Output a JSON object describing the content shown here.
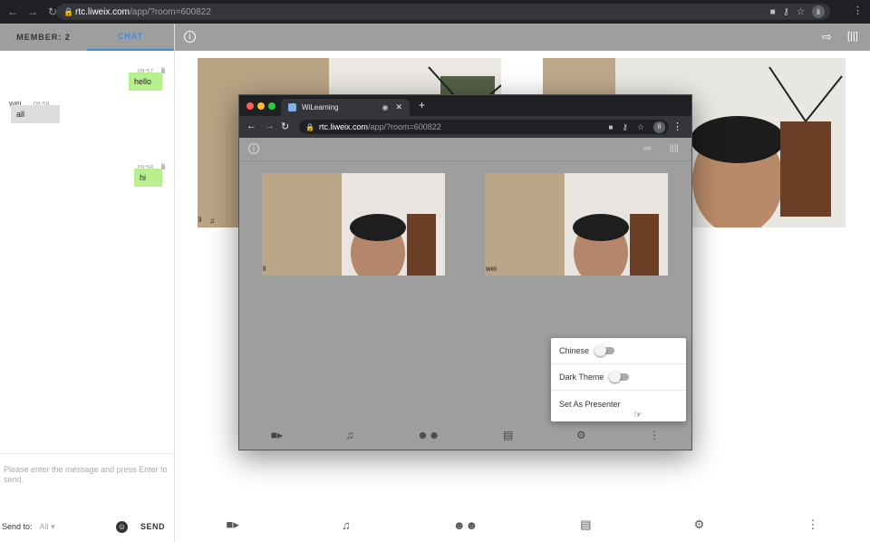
{
  "browser": {
    "url_host": "rtc.liweix.com",
    "url_path": "/app/?room=600822",
    "profile_initial": "li"
  },
  "left_panel": {
    "tabs": [
      {
        "label": "MEMBER: 2"
      },
      {
        "label": "CHAT"
      }
    ],
    "messages": [
      {
        "time": "09:57",
        "name": "li",
        "text": "hello",
        "side": "right"
      },
      {
        "time": "09:58",
        "name": "wei",
        "text": "all",
        "side": "left"
      },
      {
        "time": "09:58",
        "name": "li",
        "text": "hi",
        "side": "right"
      }
    ],
    "composer": {
      "placeholder": "Please enter the message and press Enter to send.",
      "send_to_label": "Send to:",
      "send_to_value": "All",
      "send_button": "SEND"
    }
  },
  "main": {
    "videos": [
      {
        "label": "li"
      },
      {
        "label": ""
      }
    ]
  },
  "inner_window": {
    "tab_title": "WiLearning",
    "url_host": "rtc.liweix.com",
    "url_path": "/app/?room=600822",
    "profile_initial": "li",
    "videos": [
      {
        "label": "li"
      },
      {
        "label": "wei"
      }
    ],
    "settings_menu": {
      "items": [
        {
          "label": "Chinese",
          "type": "toggle",
          "on": false
        },
        {
          "label": "Dark Theme",
          "type": "toggle",
          "on": false
        },
        {
          "label": "Set As Presenter",
          "type": "action"
        }
      ]
    }
  },
  "colors": {
    "toolbar_gray": "#9e9e9e",
    "chat_accent": "#3b8fd8",
    "own_bubble": "#b7f08c",
    "other_bubble": "#dddddd"
  }
}
